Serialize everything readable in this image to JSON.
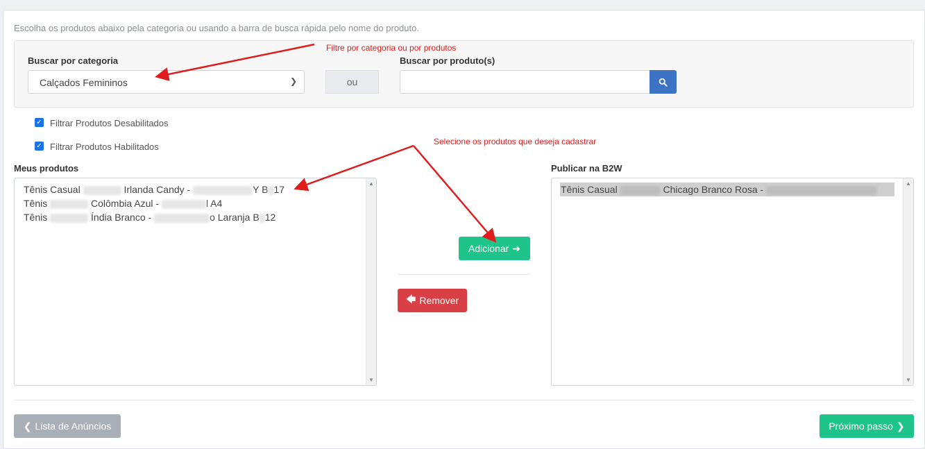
{
  "intro_text": "Escolha os produtos abaixo pela categoria ou usando a barra de busca rápida pelo nome do produto.",
  "filter": {
    "category_label": "Buscar por categoria",
    "category_value": "Calçados Femininos",
    "or_label": "ou",
    "product_search_label": "Buscar por produto(s)",
    "product_search_value": "",
    "search_icon": "search-icon"
  },
  "checkboxes": [
    {
      "label": "Filtrar Produtos Desabilitados",
      "checked": true
    },
    {
      "label": "Filtrar Produtos Habilitados",
      "checked": true
    }
  ],
  "my_products": {
    "label": "Meus produtos",
    "items": [
      {
        "prefix": "Tênis Casual",
        "middle": "Irlanda Candy -",
        "tail1": "Y B",
        "tail2": "17"
      },
      {
        "prefix": "Tênis",
        "middle": "Colômbia Azul -",
        "tail1": "l A4",
        "tail2": ""
      },
      {
        "prefix": "Tênis",
        "middle": "Índia Branco -",
        "tail1": "o Laranja B",
        "tail2": "12"
      }
    ]
  },
  "publish": {
    "label": "Publicar na B2W",
    "items": [
      {
        "prefix": "Tênis Casual",
        "middle": "Chicago Branco Rosa -"
      }
    ]
  },
  "buttons": {
    "add": "Adicionar",
    "remove": "Remover",
    "back": "Lista de Anúncios",
    "next": "Próximo passo"
  },
  "annotations": {
    "filter_hint": "Filtre por categoria ou por produtos",
    "select_hint": "Selecione os produtos que deseja cadastrar"
  },
  "colors": {
    "primary_green": "#1ec48a",
    "danger_red": "#d94045",
    "search_blue": "#3d73c4",
    "annotation_red": "#e01b1b"
  }
}
